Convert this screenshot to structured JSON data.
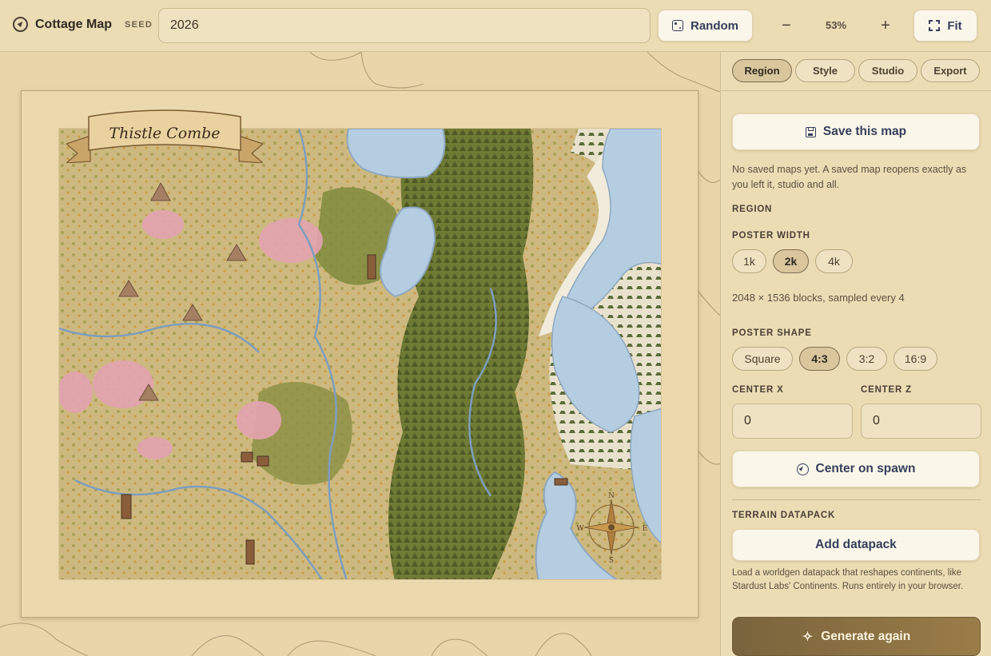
{
  "app": {
    "title": "Cottage Map"
  },
  "seed": {
    "label": "SEED",
    "value": "2026"
  },
  "toolbar": {
    "random_label": "Random",
    "zoom_out_symbol": "−",
    "zoom_level": "53%",
    "zoom_in_symbol": "+",
    "fit_label": "Fit"
  },
  "map": {
    "title": "Thistle Combe",
    "compass": {
      "n": "N",
      "e": "E",
      "s": "S",
      "w": "W"
    }
  },
  "panel": {
    "tabs": [
      {
        "label": "Region",
        "active": true
      },
      {
        "label": "Style",
        "active": false
      },
      {
        "label": "Studio",
        "active": false
      },
      {
        "label": "Export",
        "active": false
      }
    ],
    "save_label": "Save this map",
    "save_note": "No saved maps yet. A saved map reopens exactly as you left it, studio and all.",
    "region_label": "REGION",
    "poster_width_label": "POSTER WIDTH",
    "width_options": [
      {
        "label": "1k",
        "active": false
      },
      {
        "label": "2k",
        "active": true
      },
      {
        "label": "4k",
        "active": false
      }
    ],
    "blocks_info": "2048 × 1536 blocks, sampled every 4",
    "poster_shape_label": "POSTER SHAPE",
    "shape_options": [
      {
        "label": "Square",
        "active": false
      },
      {
        "label": "4:3",
        "active": true
      },
      {
        "label": "3:2",
        "active": false
      },
      {
        "label": "16:9",
        "active": false
      }
    ],
    "center_x_label": "CENTER X",
    "center_x_value": "0",
    "center_z_label": "CENTER Z",
    "center_z_value": "0",
    "center_spawn_label": "Center on spawn",
    "terrain_label": "TERRAIN DATAPACK",
    "add_datapack_label": "Add datapack",
    "datapack_note": "Load a worldgen datapack that reshapes continents, like Stardust Labs' Continents. Runs entirely in your browser.",
    "generate_label": "Generate again"
  },
  "icons": {
    "brand": "compass-icon",
    "random": "dice-icon",
    "fit": "expand-icon",
    "save": "floppy-disk-icon",
    "center": "compass-icon",
    "generate": "sparkle-icon"
  },
  "colors": {
    "accent": "#8a6f42",
    "button_text": "#34405a",
    "water": "#b5cde0",
    "forest": "#5e6a2c"
  }
}
